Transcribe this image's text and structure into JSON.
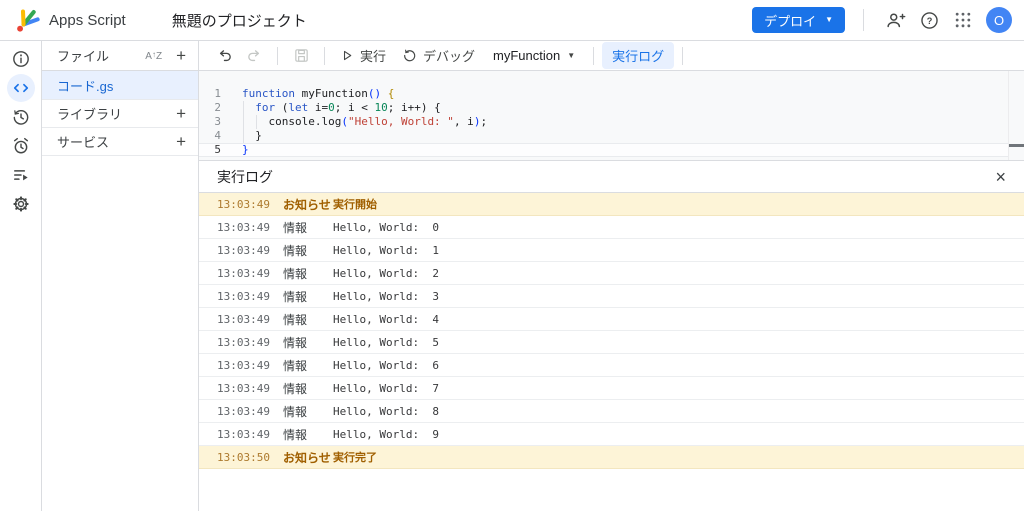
{
  "header": {
    "app_name": "Apps Script",
    "project_title": "無題のプロジェクト",
    "deploy_label": "デプロイ",
    "avatar_letter": "O"
  },
  "rail_icons": [
    "overview-info-icon",
    "code-editor-icon",
    "project-history-icon",
    "triggers-alarm-icon",
    "executions-list-icon",
    "settings-gear-icon"
  ],
  "header_icons": [
    "share-person-add-icon",
    "help-icon",
    "google-apps-grid-icon"
  ],
  "file_panel": {
    "title": "ファイル",
    "sort_icon": "sort-az-icon",
    "files": [
      {
        "name": "コード.gs",
        "selected": true
      }
    ],
    "library_label": "ライブラリ",
    "services_label": "サービス"
  },
  "toolbar": {
    "undo_icon": "undo-icon",
    "redo_icon": "redo-icon",
    "save_icon": "save-icon",
    "run_label": "実行",
    "debug_label": "デバッグ",
    "selected_function": "myFunction",
    "log_button_label": "実行ログ"
  },
  "editor": {
    "current_line": 5,
    "lines": [
      {
        "num": 1,
        "tokens": [
          [
            "function",
            "kw"
          ],
          [
            " myFunction",
            "pln"
          ],
          [
            "()",
            "pb"
          ],
          [
            " ",
            "pln"
          ],
          [
            "{",
            "pg"
          ]
        ]
      },
      {
        "num": 2,
        "tokens": [
          [
            "  ",
            "pln"
          ],
          [
            "for",
            "kw"
          ],
          [
            " (",
            "pln"
          ],
          [
            "let",
            "kw"
          ],
          [
            " i=",
            "pln"
          ],
          [
            "0",
            "num"
          ],
          [
            "; i < ",
            "pln"
          ],
          [
            "10",
            "num"
          ],
          [
            "; i++) {",
            "pln"
          ]
        ]
      },
      {
        "num": 3,
        "tokens": [
          [
            "    console.log",
            "pln"
          ],
          [
            "(",
            "pb"
          ],
          [
            "\"Hello, World: \"",
            "str"
          ],
          [
            ", i",
            "pln"
          ],
          [
            ")",
            "pb"
          ],
          [
            ";",
            "pln"
          ]
        ]
      },
      {
        "num": 4,
        "tokens": [
          [
            "  }",
            "pln"
          ]
        ]
      },
      {
        "num": 5,
        "tokens": [
          [
            "}",
            "pb"
          ]
        ]
      }
    ]
  },
  "log_panel": {
    "title": "実行ログ",
    "rows": [
      {
        "time": "13:03:49",
        "type": "お知らせ",
        "message": "実行開始",
        "kind": "notice"
      },
      {
        "time": "13:03:49",
        "type": "情報",
        "message": "Hello, World:  0",
        "kind": "info"
      },
      {
        "time": "13:03:49",
        "type": "情報",
        "message": "Hello, World:  1",
        "kind": "info"
      },
      {
        "time": "13:03:49",
        "type": "情報",
        "message": "Hello, World:  2",
        "kind": "info"
      },
      {
        "time": "13:03:49",
        "type": "情報",
        "message": "Hello, World:  3",
        "kind": "info"
      },
      {
        "time": "13:03:49",
        "type": "情報",
        "message": "Hello, World:  4",
        "kind": "info"
      },
      {
        "time": "13:03:49",
        "type": "情報",
        "message": "Hello, World:  5",
        "kind": "info"
      },
      {
        "time": "13:03:49",
        "type": "情報",
        "message": "Hello, World:  6",
        "kind": "info"
      },
      {
        "time": "13:03:49",
        "type": "情報",
        "message": "Hello, World:  7",
        "kind": "info"
      },
      {
        "time": "13:03:49",
        "type": "情報",
        "message": "Hello, World:  8",
        "kind": "info"
      },
      {
        "time": "13:03:49",
        "type": "情報",
        "message": "Hello, World:  9",
        "kind": "info"
      },
      {
        "time": "13:03:50",
        "type": "お知らせ",
        "message": "実行完了",
        "kind": "notice"
      }
    ]
  },
  "colors": {
    "accent": "#1a73e8",
    "selected_bg": "#e8f0fe",
    "notice_bg": "#fdf4d7",
    "notice_text": "#a05f00",
    "editor_bg": "#f8f9fa"
  }
}
